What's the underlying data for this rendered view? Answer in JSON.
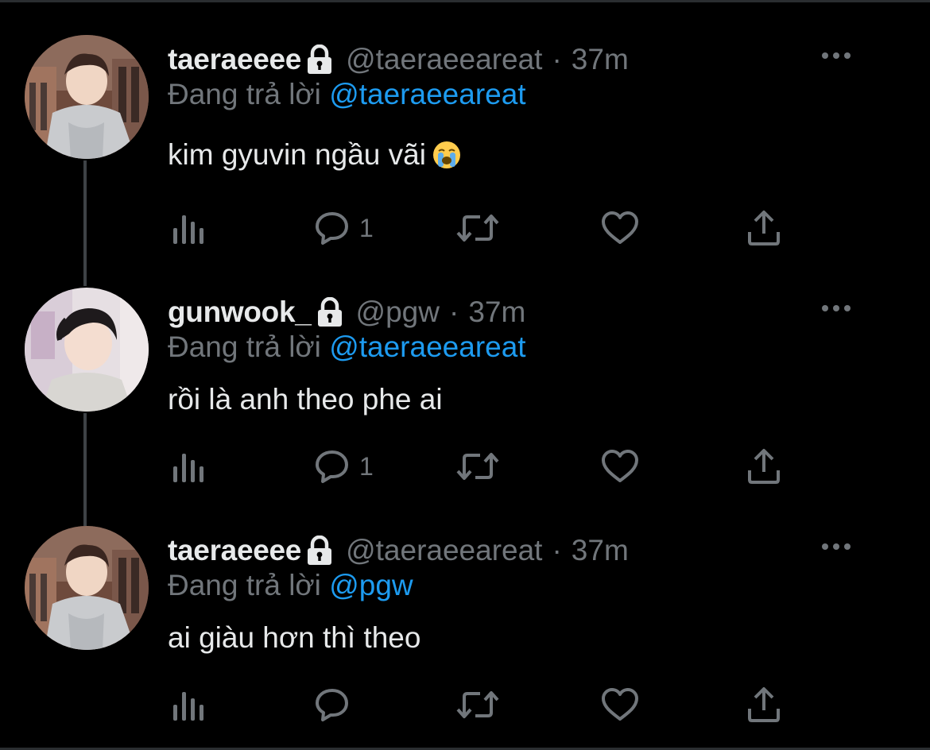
{
  "colors": {
    "background": "#000000",
    "text_primary": "#e7e9ea",
    "text_secondary": "#71767b",
    "mention": "#1d9bf0",
    "thread_line": "#3e4246"
  },
  "reply_prefix": "Đang trả lời",
  "tweets": [
    {
      "display_name": "taeraeeee",
      "handle": "@taeraeeareat",
      "separator": "·",
      "time": "37m",
      "replying_to": "@taeraeeareat",
      "text": "kim gyuvin ngầu vãi",
      "emoji": "loudly-crying-face",
      "reply_count": "1",
      "protected": true,
      "avatar": "avatar-taeraeeee"
    },
    {
      "display_name": "gunwook_",
      "handle": "@pgw",
      "separator": "·",
      "time": "37m",
      "replying_to": "@taeraeeareat",
      "text": "rồi là anh theo phe ai",
      "reply_count": "1",
      "protected": true,
      "avatar": "avatar-gunwook"
    },
    {
      "display_name": "taeraeeee",
      "handle": "@taeraeeareat",
      "separator": "·",
      "time": "37m",
      "replying_to": "@pgw",
      "text": "ai giàu hơn thì theo",
      "reply_count": "",
      "protected": true,
      "avatar": "avatar-taeraeeee"
    }
  ],
  "action_icons": [
    "analytics-icon",
    "reply-icon",
    "retweet-icon",
    "like-icon",
    "share-icon"
  ],
  "more_icon": "more-icon",
  "lock_icon": "lock-icon"
}
